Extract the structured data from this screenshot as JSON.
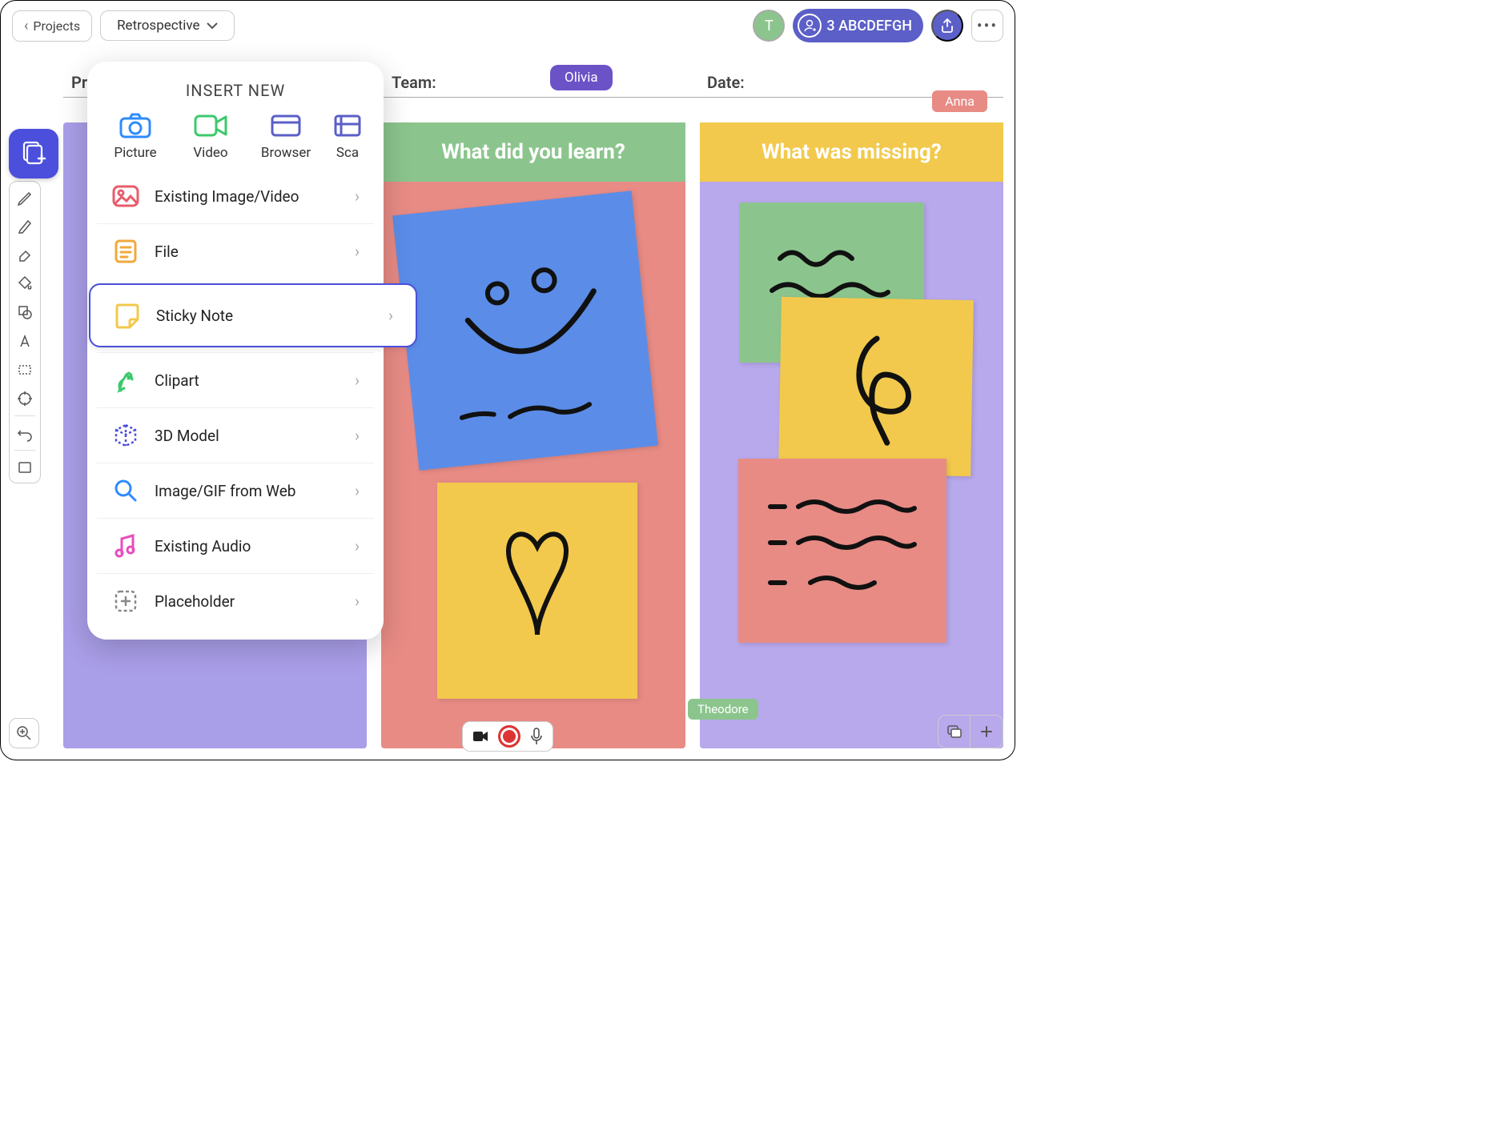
{
  "topbar": {
    "back_label": "Projects",
    "title": "Retrospective",
    "avatar_letter": "T",
    "collab_count": "3 ABCDEFGH"
  },
  "labels": {
    "project": "Proj",
    "team": "Team:",
    "date": "Date:"
  },
  "cursors": {
    "olivia": "Olivia",
    "anna": "Anna",
    "theodore": "Theodore"
  },
  "columns": {
    "learn": "What did you learn?",
    "missing": "What was missing?"
  },
  "insert_panel": {
    "title": "INSERT NEW",
    "top_items": [
      {
        "label": "Picture",
        "icon": "camera-icon",
        "color": "#2D8CFF"
      },
      {
        "label": "Video",
        "icon": "video-icon",
        "color": "#3CC96B"
      },
      {
        "label": "Browser",
        "icon": "browser-icon",
        "color": "#5B5FC7"
      },
      {
        "label": "Sca",
        "icon": "scan-icon",
        "color": "#5B5FC7"
      }
    ],
    "list_items": [
      {
        "label": "Existing Image/Video",
        "icon": "image-icon",
        "color": "#E85D6B"
      },
      {
        "label": "File",
        "icon": "file-icon",
        "color": "#F2A93C"
      },
      {
        "label": "Sticky Note",
        "icon": "sticky-icon",
        "color": "#F2C94C",
        "selected": true
      },
      {
        "label": "Clipart",
        "icon": "clipart-icon",
        "color": "#3CC96B"
      },
      {
        "label": "3D Model",
        "icon": "cube-icon",
        "color": "#4B4FDC"
      },
      {
        "label": "Image/GIF from Web",
        "icon": "search-icon",
        "color": "#2D8CFF"
      },
      {
        "label": "Existing Audio",
        "icon": "audio-icon",
        "color": "#E84DBE"
      },
      {
        "label": "Placeholder",
        "icon": "placeholder-icon",
        "color": "#888"
      }
    ]
  },
  "toolbar_icons": [
    "insert",
    "pen",
    "marker",
    "eraser",
    "fill",
    "shape",
    "text",
    "select",
    "target",
    "undo",
    "fullscreen"
  ]
}
